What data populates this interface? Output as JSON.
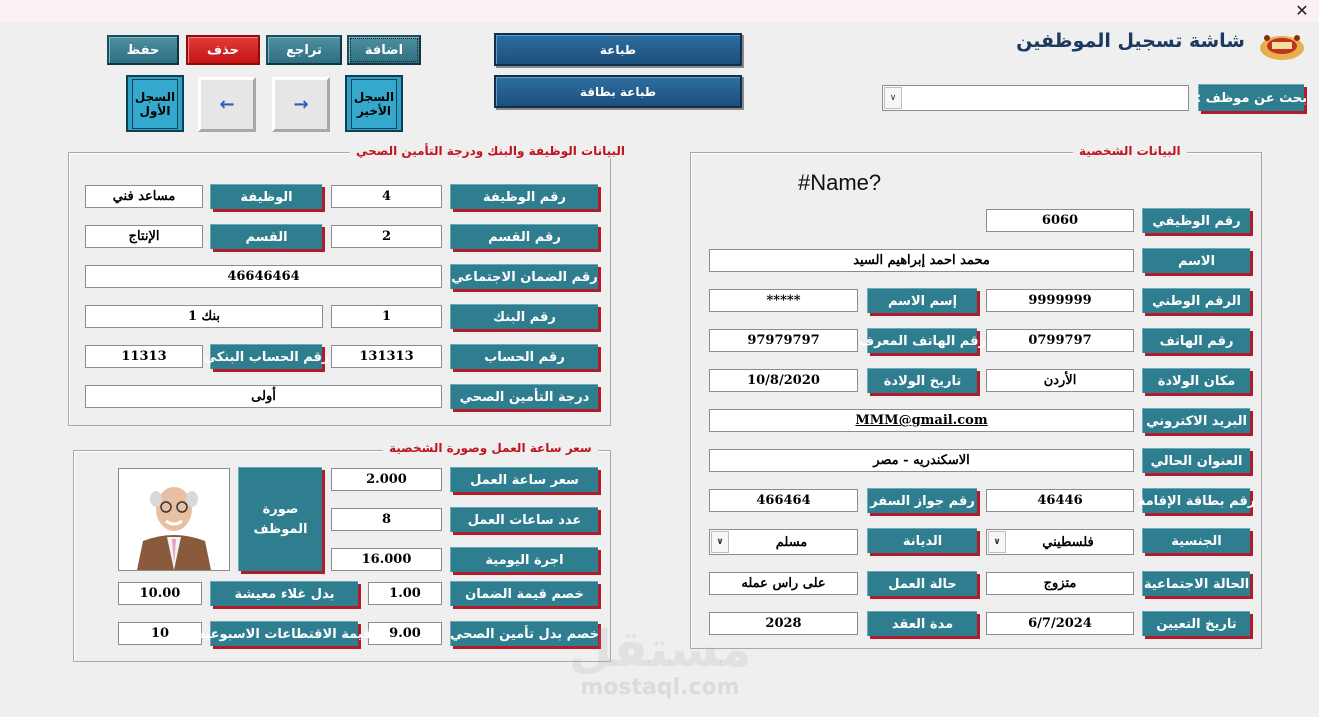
{
  "window": {
    "close_glyph": "✕"
  },
  "header": {
    "title": "شاشة تسجيل الموظفين"
  },
  "toolbar": {
    "save": "حفظ",
    "delete": "حذف",
    "undo": "تراجع",
    "add": "اضافة",
    "print": "طباعة",
    "print_card": "طباعة بطاقة"
  },
  "nav": {
    "first": "السجل الأول",
    "last": "السجل الأخير",
    "prev_glyph": "←",
    "next_glyph": "→"
  },
  "search": {
    "label": "بحث عن موظف :",
    "value": ""
  },
  "personal": {
    "section_title": "البيانات الشخصية",
    "name_field": "#Name?",
    "emp_no": {
      "label": "رقم الوظيفي",
      "value": "6060"
    },
    "name": {
      "label": "الاسم",
      "value": "محمد احمد إبراهيم السيد"
    },
    "national_id": {
      "label": "الرقم الوطني",
      "value": "9999999"
    },
    "full_name_label": {
      "label": "إسم الاسم",
      "value": "*****"
    },
    "phone": {
      "label": "رقم الهاتف",
      "value": "0799797"
    },
    "ref_phone": {
      "label": "رقم الهاتف المعرف",
      "value": "97979797"
    },
    "birth_place": {
      "label": "مكان الولادة",
      "value": "الأردن"
    },
    "birth_date": {
      "label": "تاريخ الولادة",
      "value": "10/8/2020"
    },
    "email": {
      "label": "البريد الاكتروني",
      "value": "MMM@gmail.com"
    },
    "address": {
      "label": "العنوان الحالي",
      "value": "الاسكندريه - مصر"
    },
    "residence_no": {
      "label": "رقم بطاقة الإقامة",
      "value": "46446"
    },
    "passport_no": {
      "label": "رقم جواز السفر",
      "value": "466464"
    },
    "nationality": {
      "label": "الجنسية",
      "value": "فلسطيني"
    },
    "religion": {
      "label": "الديانة",
      "value": "مسلم"
    },
    "marital": {
      "label": "الحالة الاجتماعية",
      "value": "متزوج"
    },
    "work_status": {
      "label": "حالة العمل",
      "value": "على راس عمله"
    },
    "hire_date": {
      "label": "تاريخ التعيين",
      "value": "6/7/2024"
    },
    "contract": {
      "label": "مدة العقد",
      "value": "2028"
    }
  },
  "job": {
    "section_title": "البيانات الوظيفة والبنك ودرجة التأمين الصحي",
    "job_no": {
      "label": "رقم الوظيفة",
      "value": "4"
    },
    "job_title": {
      "label": "الوظيفة",
      "value": "مساعد فني"
    },
    "dept_no": {
      "label": "رقم القسم",
      "value": "2"
    },
    "dept": {
      "label": "القسم",
      "value": "الإنتاج"
    },
    "social_security": {
      "label": "رقم الضمان الاجتماعي",
      "value": "46646464"
    },
    "bank_no": {
      "label": "رقم البنك",
      "value": "1"
    },
    "bank_name": {
      "value": "بنك 1"
    },
    "account": {
      "label": "رقم الحساب",
      "value": "131313"
    },
    "bank_account": {
      "label": "رقم الحساب البنكي",
      "value": "11313"
    },
    "insurance": {
      "label": "درجة التأمين الصحي",
      "value": "أولى"
    }
  },
  "wage": {
    "section_title": "سعر ساعة العمل وصورة الشخصية",
    "hour_rate": {
      "label": "سعر ساعة العمل",
      "value": "2.000"
    },
    "hours": {
      "label": "عدد ساعات العمل",
      "value": "8"
    },
    "daily": {
      "label": "اجرة اليومية",
      "value": "16.000"
    },
    "photo_label": "صورة الموظف",
    "ss_deduct": {
      "label": "خصم قيمة الضمان",
      "value": "1.00"
    },
    "cost_of_living": {
      "label": "بدل غلاء معيشة",
      "value": "10.00"
    },
    "health_deduct": {
      "label": "خصم بدل تأمين الصحي",
      "value": "9.00"
    },
    "weekly_deduct": {
      "label": "قيمة الاقتطاعات الاسبوعية",
      "value": "10"
    }
  },
  "watermark": {
    "ar": "مستقل",
    "en": "mostaql.com"
  }
}
